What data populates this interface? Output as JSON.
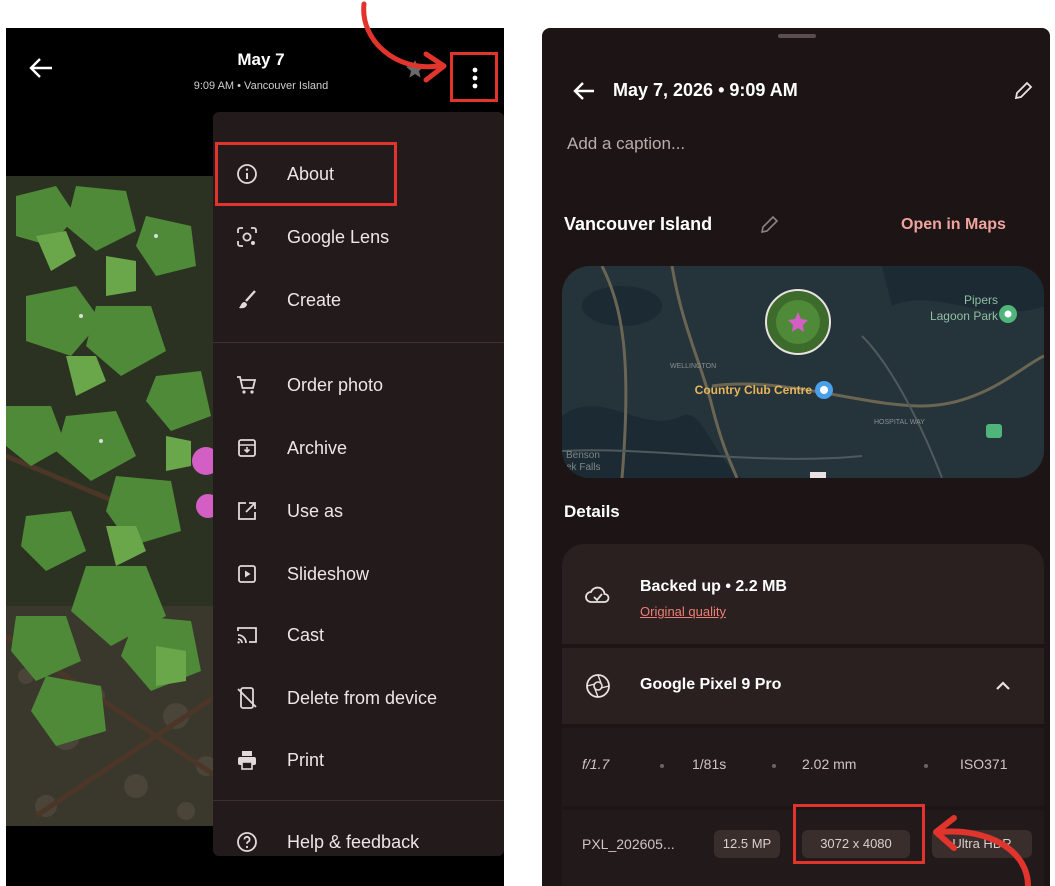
{
  "left": {
    "title": "May 7",
    "subtitle": "9:09 AM • Vancouver Island",
    "menu": [
      {
        "label": "About",
        "icon": "info-icon"
      },
      {
        "label": "Google Lens",
        "icon": "lens-icon"
      },
      {
        "label": "Create",
        "icon": "brush-icon"
      },
      {
        "label": "Order photo",
        "icon": "cart-icon"
      },
      {
        "label": "Archive",
        "icon": "archive-icon"
      },
      {
        "label": "Use as",
        "icon": "open-external-icon"
      },
      {
        "label": "Slideshow",
        "icon": "slideshow-icon"
      },
      {
        "label": "Cast",
        "icon": "cast-icon"
      },
      {
        "label": "Delete from device",
        "icon": "phone-delete-icon"
      },
      {
        "label": "Print",
        "icon": "print-icon"
      },
      {
        "label": "Help & feedback",
        "icon": "help-icon"
      }
    ]
  },
  "right": {
    "date": "May 7, 2026 • 9:09 AM",
    "caption_placeholder": "Add a caption...",
    "location": "Vancouver Island",
    "open_maps": "Open in Maps",
    "map": {
      "label_piper": "Pipers",
      "label_lagoon": "Lagoon Park",
      "label_wellington": "WELLINGTON",
      "label_country": "Country Club Centre",
      "label_benson": "Benson",
      "label_falls": "ek Falls",
      "label_road": "HOSPITAL WAY"
    },
    "details_heading": "Details",
    "backup": {
      "title": "Backed up • 2.2 MB",
      "quality": "Original quality"
    },
    "camera": {
      "name": "Google Pixel 9 Pro"
    },
    "exif": {
      "aperture": "f/1.7",
      "shutter": "1/81s",
      "focal": "2.02 mm",
      "iso": "ISO371"
    },
    "file": {
      "name": "PXL_202605...",
      "megapixels": "12.5 MP",
      "dimensions": "3072 x 4080",
      "hdr": "Ultra HDR"
    }
  },
  "colors": {
    "annotation": "#e0342c",
    "menu_bg": "#231b1b",
    "panel_bg": "#1d1515",
    "accent": "#f0a49c"
  }
}
